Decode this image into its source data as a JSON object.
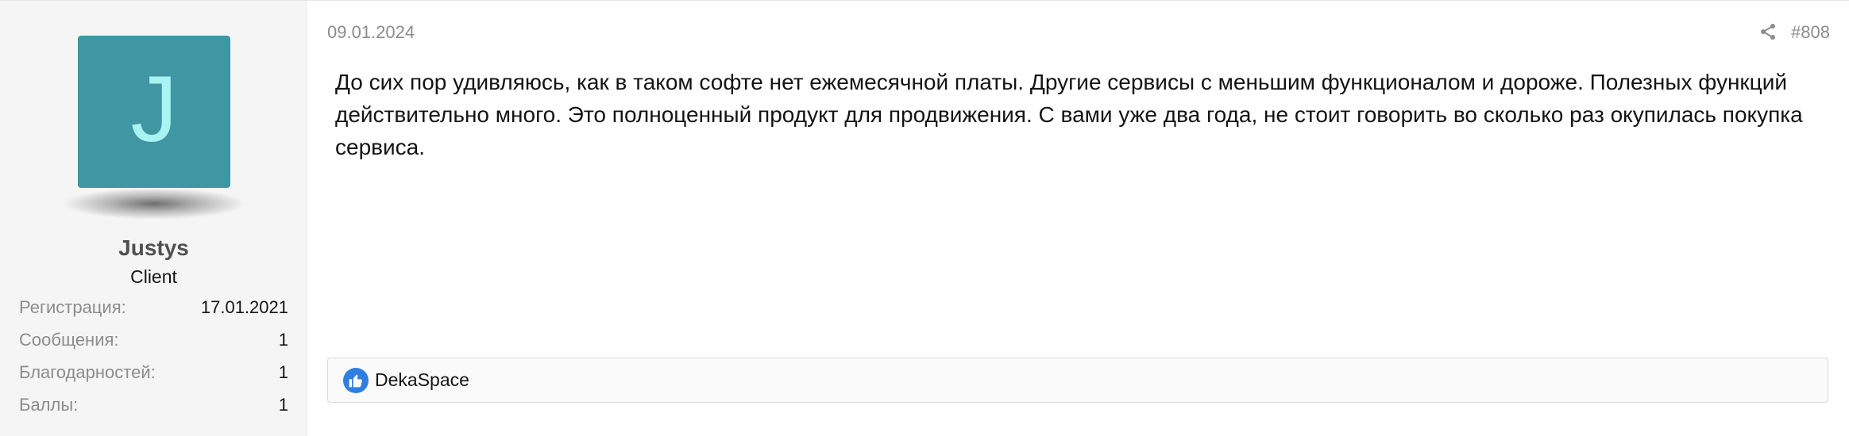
{
  "user": {
    "avatar_letter": "J",
    "avatar_bg": "#4096a3",
    "avatar_fg": "#a9f3f2",
    "name": "Justys",
    "title": "Client",
    "stats": [
      {
        "label": "Регистрация:",
        "value": "17.01.2021"
      },
      {
        "label": "Сообщения:",
        "value": "1"
      },
      {
        "label": "Благодарностей:",
        "value": "1"
      },
      {
        "label": "Баллы:",
        "value": "1"
      }
    ]
  },
  "post": {
    "date": "09.01.2024",
    "number": "#808",
    "share_icon": "share-icon",
    "message": "До сих пор удивляюсь, как в таком софте нет ежемесячной платы. Другие сервисы с меньшим функционалом и дороже. Полезных функций действительно много. Это полноценный продукт для продвижения. С вами уже два года, не стоит говорить во сколько раз окупилась покупка сервиса."
  },
  "reactions": {
    "icon": "thumbs-up-icon",
    "icon_color": "#2f7fe0",
    "users": "DekaSpace"
  }
}
